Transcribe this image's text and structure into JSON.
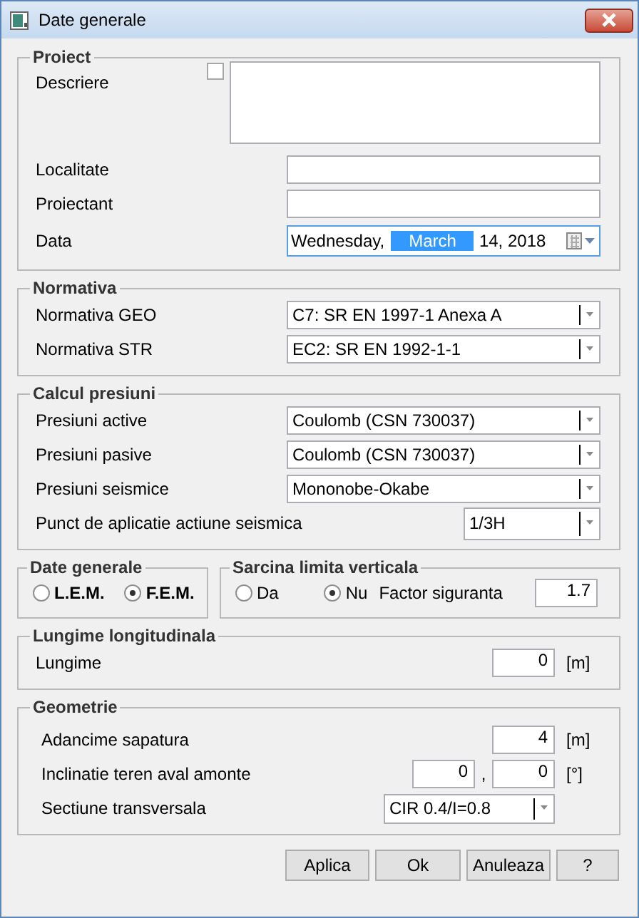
{
  "window": {
    "title": "Date generale"
  },
  "proiect": {
    "title": "Proiect",
    "fields": [
      {
        "kind": "memo",
        "label": "Descriere",
        "checked": false
      },
      {
        "kind": "text",
        "label": "Localitate"
      },
      {
        "kind": "text",
        "label": "Proiectant"
      },
      {
        "kind": "date",
        "label": "Data",
        "weekday": "Wednesday,",
        "month": "March",
        "rest": "14, 2018"
      }
    ]
  },
  "normativa": {
    "title": "Normativa",
    "rows": [
      {
        "label": "Normativa GEO",
        "value": "C7: SR EN 1997-1 Anexa A"
      },
      {
        "label": "Normativa STR",
        "value": "EC2: SR EN 1992-1-1"
      }
    ]
  },
  "calcul": {
    "title": "Calcul presiuni",
    "rows": [
      {
        "kind": "wide",
        "label": "Presiuni active",
        "value": "Coulomb (CSN 730037)"
      },
      {
        "kind": "wide",
        "label": "Presiuni pasive",
        "value": "Coulomb (CSN 730037)"
      },
      {
        "kind": "wide",
        "label": "Presiuni seismice",
        "value": "Mononobe-Okabe"
      },
      {
        "kind": "short",
        "label": "Punct de aplicatie actiune seismica",
        "value": "1/3H"
      }
    ]
  },
  "date_generale": {
    "title": "Date generale",
    "options": [
      {
        "label": "L.E.M.",
        "selected": false
      },
      {
        "label": "F.E.M.",
        "selected": true
      }
    ]
  },
  "sarcina": {
    "title": "Sarcina limita verticala",
    "options": [
      {
        "label": "Da",
        "selected": false
      },
      {
        "label": "Nu",
        "selected": true
      }
    ],
    "factor_label": "Factor siguranta",
    "factor_value": "1.7"
  },
  "lungime": {
    "title": "Lungime longitudinala",
    "label": "Lungime",
    "value": "0",
    "unit": "[m]"
  },
  "geometrie": {
    "title": "Geometrie",
    "depth": {
      "label": "Adancime sapatura",
      "value": "4",
      "unit": "[m]"
    },
    "inclination": {
      "label": "Inclinatie teren aval amonte",
      "values": [
        "0",
        "0"
      ],
      "separator": ",",
      "unit": "[°]"
    },
    "section": {
      "label": "Sectiune transversala",
      "value": "CIR 0.4/I=0.8"
    }
  },
  "buttons": [
    "Aplica",
    "Ok",
    "Anuleaza",
    "?"
  ]
}
